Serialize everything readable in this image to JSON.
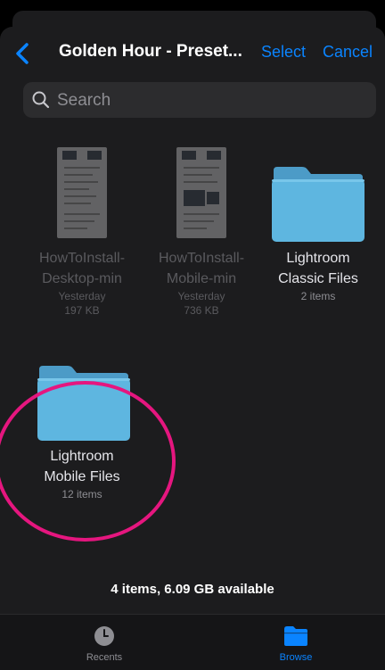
{
  "nav": {
    "title": "Golden Hour - Preset...",
    "select_label": "Select",
    "cancel_label": "Cancel"
  },
  "search": {
    "placeholder": "Search"
  },
  "files": [
    {
      "name_line1": "HowToInstall-",
      "name_line2": "Desktop-min",
      "date": "Yesterday",
      "size": "197 KB",
      "icon": "document-thumbnail"
    },
    {
      "name_line1": "HowToInstall-",
      "name_line2": "Mobile-min",
      "date": "Yesterday",
      "size": "736 KB",
      "icon": "document-thumbnail"
    },
    {
      "name_line1": "Lightroom",
      "name_line2": "Classic Files",
      "count": "2 items",
      "icon": "folder-icon"
    },
    {
      "name_line1": "Lightroom",
      "name_line2": "Mobile Files",
      "count": "12 items",
      "icon": "folder-icon"
    }
  ],
  "status": "4 items, 6.09 GB available",
  "tabs": [
    {
      "label": "Recents",
      "icon": "clock-icon"
    },
    {
      "label": "Browse",
      "icon": "folder-icon"
    }
  ],
  "colors": {
    "accent": "#0a84ff",
    "folder": "#5eb6e0",
    "highlight_circle": "#e5167f",
    "background": "#1c1c1e"
  }
}
